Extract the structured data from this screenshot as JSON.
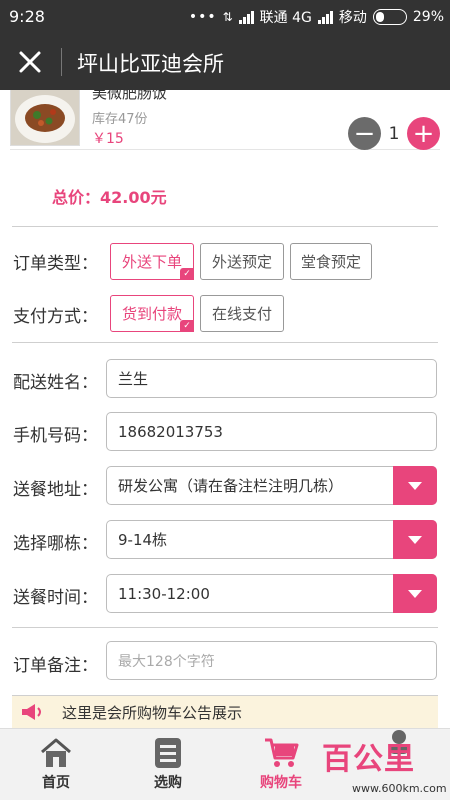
{
  "status_bar": {
    "time": "9:28",
    "carrier1": "联通 4G",
    "carrier2": "移动",
    "battery": "29%"
  },
  "header": {
    "title": "坪山比亚迪会所",
    "close_icon": "close-icon"
  },
  "product": {
    "name": "美微肥肠饭",
    "stock": "库存47份",
    "price": "￥15",
    "quantity": "1",
    "minus_label": "−",
    "plus_label": "+"
  },
  "total": {
    "label": "总价：42.00元"
  },
  "order_type": {
    "label": "订单类型：",
    "options": [
      {
        "label": "外送下单",
        "selected": true
      },
      {
        "label": "外送预定",
        "selected": false
      },
      {
        "label": "堂食预定",
        "selected": false
      }
    ]
  },
  "payment": {
    "label": "支付方式：",
    "options": [
      {
        "label": "货到付款",
        "selected": true
      },
      {
        "label": "在线支付",
        "selected": false
      }
    ]
  },
  "form": {
    "name_label": "配送姓名：",
    "name_value": "兰生",
    "phone_label": "手机号码：",
    "phone_value": "18682013753",
    "address_label": "送餐地址：",
    "address_value": "研发公寓（请在备注栏注明几栋）",
    "building_label": "选择哪栋：",
    "building_value": "9-14栋",
    "time_label": "送餐时间：",
    "time_value": "11:30-12:00",
    "note_label": "订单备注：",
    "note_placeholder": "最大128个字符"
  },
  "notice": {
    "text": "这里是会所购物车公告展示"
  },
  "bottom_nav": [
    {
      "label": "首页",
      "icon": "home-icon",
      "active": false
    },
    {
      "label": "选购",
      "icon": "list-icon",
      "active": false
    },
    {
      "label": "购物车",
      "icon": "cart-icon",
      "active": true
    }
  ],
  "watermark": {
    "text": "百公里",
    "url": "www.600km.com"
  },
  "colors": {
    "accent": "#e8457c",
    "header_bg": "#333333",
    "notice_bg": "#fbf3dd"
  }
}
